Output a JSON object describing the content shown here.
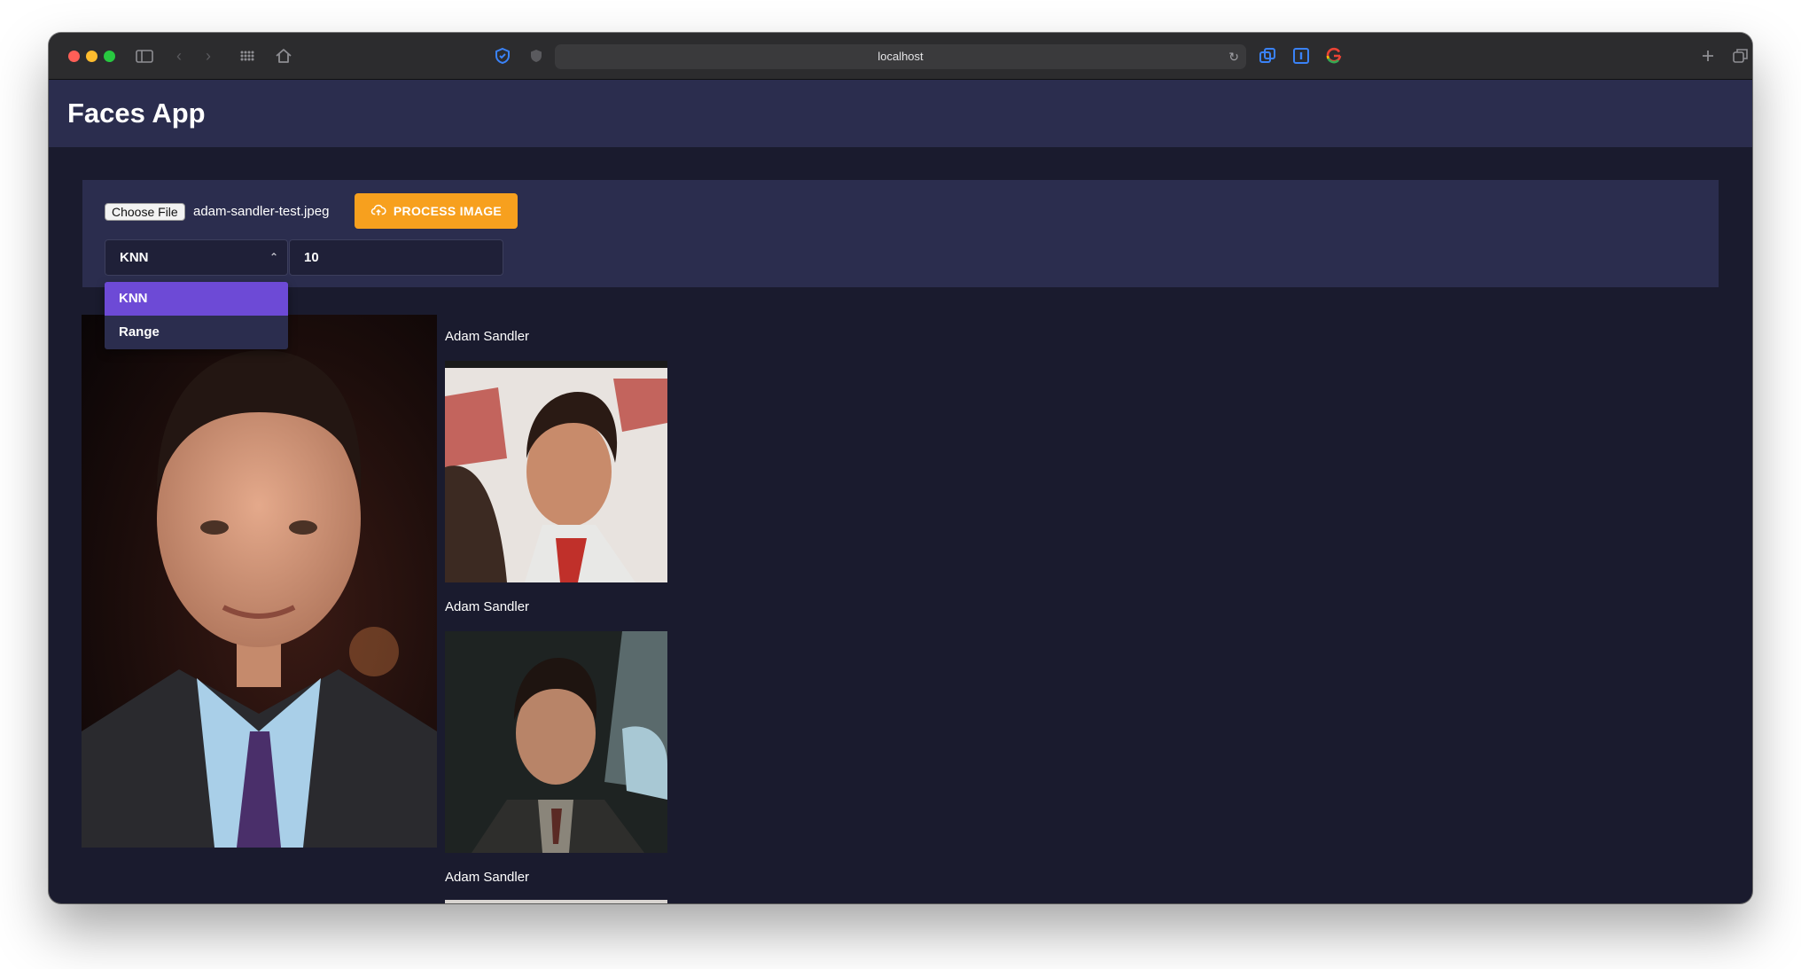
{
  "browser": {
    "url": "localhost"
  },
  "app": {
    "title": "Faces App"
  },
  "upload": {
    "choose_file_label": "Choose File",
    "file_name": "adam-sandler-test.jpeg",
    "process_button_label": "PROCESS IMAGE"
  },
  "search": {
    "mode_selected": "KNN",
    "k_value": "10",
    "mode_options": [
      "KNN",
      "Range"
    ]
  },
  "results": [
    {
      "name": "Adam Sandler"
    },
    {
      "name": "Adam Sandler"
    },
    {
      "name": "Adam Sandler"
    }
  ],
  "colors": {
    "accent_orange": "#f7a01e",
    "menu_highlight": "#6d4ad6",
    "app_bar": "#2b2d4e",
    "background": "#1a1b2e"
  }
}
